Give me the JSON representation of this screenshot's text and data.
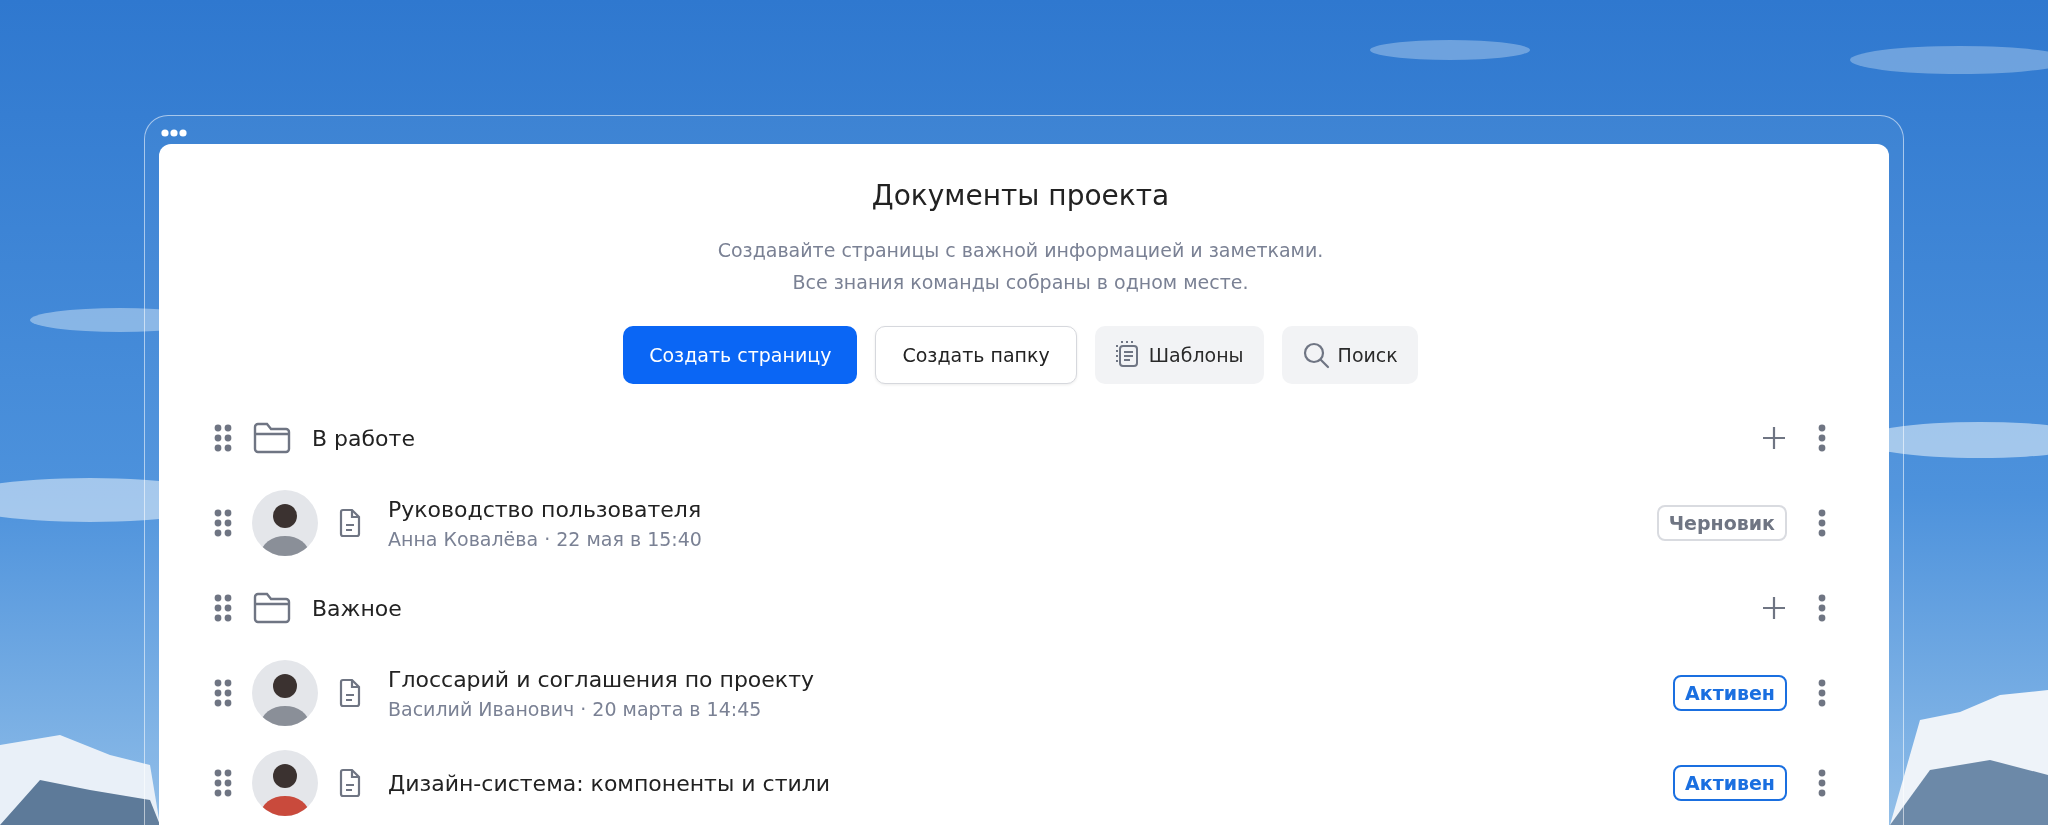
{
  "title": "Документы проекта",
  "subtitle": [
    "Создавайте страницы с важной информацией и заметками.",
    "Все знания команды собраны в одном месте."
  ],
  "actions": [
    {
      "label": "Создать страницу",
      "kind": "primary"
    },
    {
      "label": "Создать папку",
      "kind": "outline"
    },
    {
      "label": "Шаблоны",
      "kind": "templates"
    },
    {
      "label": "Поиск",
      "kind": "search"
    }
  ],
  "items": [
    {
      "kind": "folder",
      "name": "В работе"
    },
    {
      "kind": "document",
      "name": "Руководство пользователя",
      "meta": "Анна Ковалёва · 22 мая в 15:40",
      "status": {
        "kind": "draft",
        "label": "Черновик"
      }
    },
    {
      "kind": "folder",
      "name": "Важное"
    },
    {
      "kind": "document",
      "name": "Глоссарий и соглашения по проекту",
      "meta": "Василий Иванович · 20 марта в 14:45",
      "status": {
        "kind": "active",
        "label": "Активен"
      }
    },
    {
      "kind": "document",
      "name": "Дизайн-система: компоненты и стили",
      "status": {
        "kind": "active",
        "label": "Активен"
      }
    }
  ]
}
